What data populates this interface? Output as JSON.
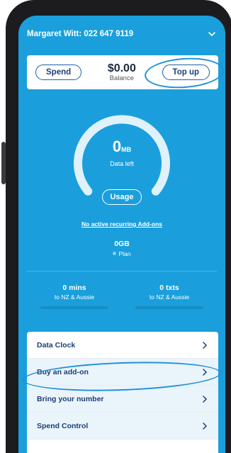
{
  "header": {
    "account_label": "Margaret Witt: 022 647 9119"
  },
  "balance": {
    "spend_label": "Spend",
    "amount": "$0.00",
    "amount_label": "Balance",
    "topup_label": "Top up"
  },
  "data_gauge": {
    "value": "0",
    "unit": "MB",
    "label": "Data left",
    "usage_label": "Usage",
    "fill_fraction": 0
  },
  "addons_link": "No active recurring Add-ons",
  "plan": {
    "amount": "0GB",
    "label": "Plan"
  },
  "stats": [
    {
      "value": "0 mins",
      "sub": "to NZ & Aussie"
    },
    {
      "value": "0 txts",
      "sub": "to NZ & Aussie"
    }
  ],
  "menu": [
    {
      "label": "Data Clock"
    },
    {
      "label": "Buy an add-on"
    },
    {
      "label": "Bring your number"
    },
    {
      "label": "Spend Control"
    }
  ],
  "colors": {
    "brand_blue": "#1a9fdc",
    "accent_navy": "#1c3f76",
    "annotation": "#1e90d8"
  }
}
